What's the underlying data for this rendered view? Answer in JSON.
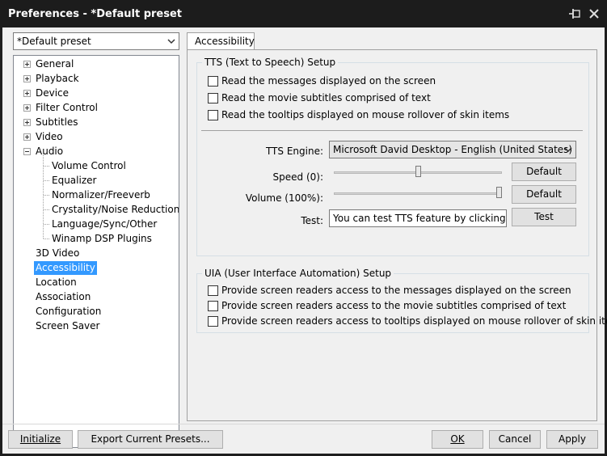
{
  "window": {
    "title": "Preferences - *Default preset"
  },
  "preset": {
    "selected": "*Default preset"
  },
  "tree": [
    {
      "label": "General",
      "expander": "plus"
    },
    {
      "label": "Playback",
      "expander": "plus"
    },
    {
      "label": "Device",
      "expander": "plus"
    },
    {
      "label": "Filter Control",
      "expander": "plus"
    },
    {
      "label": "Subtitles",
      "expander": "plus"
    },
    {
      "label": "Video",
      "expander": "plus"
    },
    {
      "label": "Audio",
      "expander": "minus"
    },
    {
      "label": "Volume Control",
      "child": true
    },
    {
      "label": "Equalizer",
      "child": true
    },
    {
      "label": "Normalizer/Freeverb",
      "child": true
    },
    {
      "label": "Crystality/Noise Reduction",
      "child": true
    },
    {
      "label": "Language/Sync/Other",
      "child": true
    },
    {
      "label": "Winamp DSP Plugins",
      "child": true
    },
    {
      "label": "3D Video"
    },
    {
      "label": "Accessibility",
      "selected": true
    },
    {
      "label": "Location"
    },
    {
      "label": "Association"
    },
    {
      "label": "Configuration"
    },
    {
      "label": "Screen Saver"
    }
  ],
  "tab": {
    "label": "Accessibility"
  },
  "tts": {
    "legend": "TTS (Text to Speech) Setup",
    "options": [
      {
        "label": "Read the messages displayed on the screen",
        "checked": false
      },
      {
        "label": "Read the movie subtitles comprised of text",
        "checked": false
      },
      {
        "label": "Read the tooltips displayed on mouse rollover of skin items",
        "checked": false
      }
    ],
    "engine_label": "TTS Engine:",
    "engine_value": "Microsoft David Desktop - English (United States)",
    "speed_label": "Speed (0):",
    "speed_fraction": 0.5,
    "speed_default": "Default",
    "volume_label": "Volume (100%):",
    "volume_fraction": 1.0,
    "volume_default": "Default",
    "test_label": "Test:",
    "test_value": "You can test TTS feature by clicking test",
    "test_button": "Test"
  },
  "uia": {
    "legend": "UIA (User Interface Automation) Setup",
    "options": [
      {
        "label": "Provide screen readers access to the messages displayed on the screen",
        "checked": false
      },
      {
        "label": "Provide screen readers access to the movie subtitles comprised of text",
        "checked": false
      },
      {
        "label": "Provide screen readers access to tooltips displayed on mouse rollover of skin items",
        "checked": false
      }
    ]
  },
  "buttons": {
    "initialize": "Initialize",
    "export": "Export Current Presets...",
    "ok": "OK",
    "cancel": "Cancel",
    "apply": "Apply"
  },
  "colors": {
    "titlebar": "#1c1c1c",
    "selection": "#3399ff",
    "dialog": "#f0f0f0"
  }
}
